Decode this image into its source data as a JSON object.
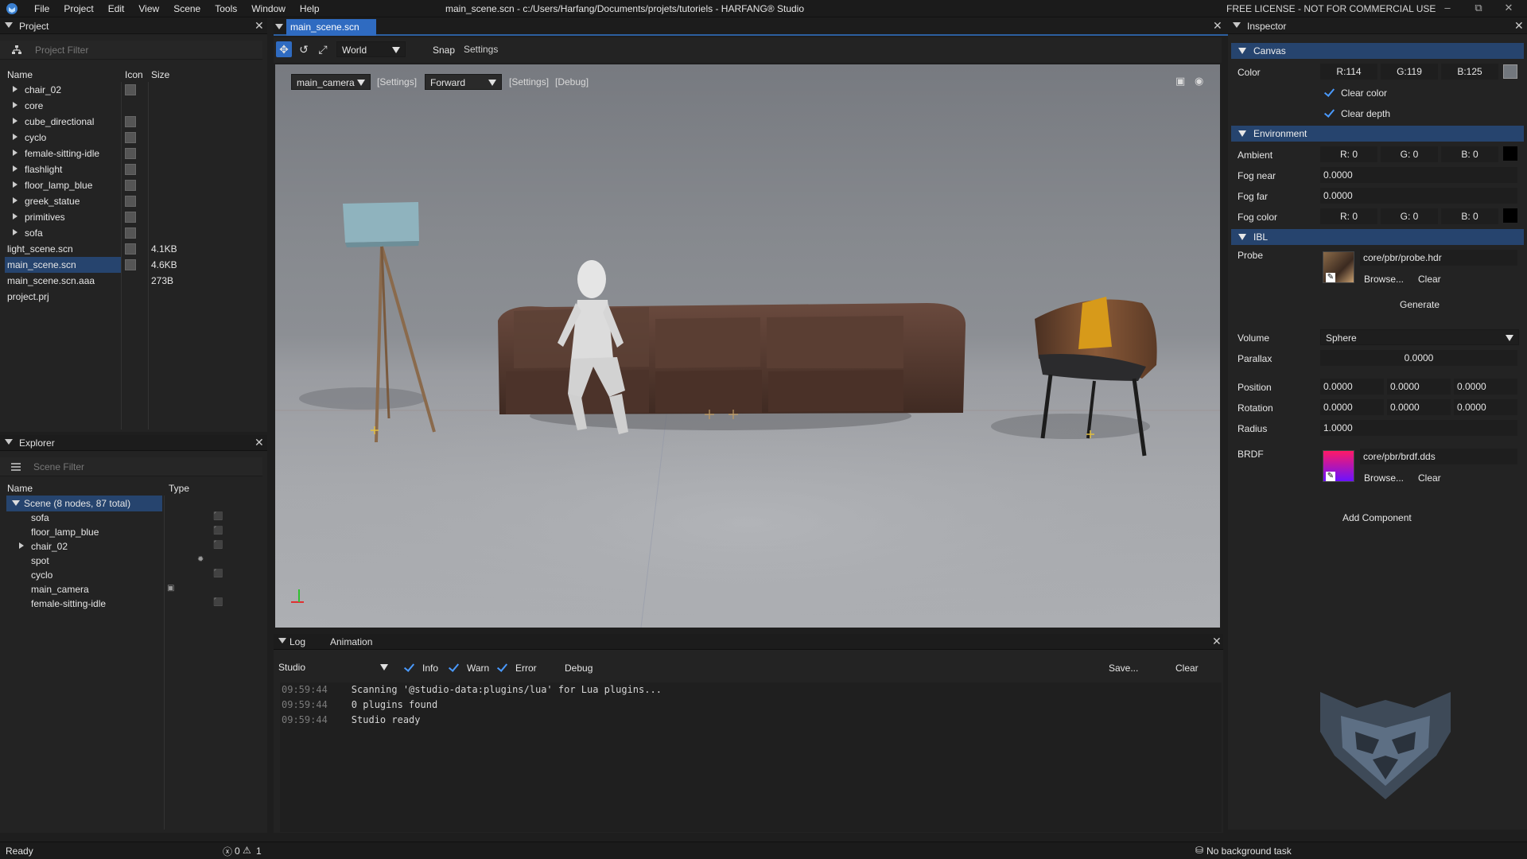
{
  "window": {
    "title": "main_scene.scn - c:/Users/Harfang/Documents/projets/tutoriels - HARFANG® Studio",
    "license": "FREE LICENSE - NOT FOR COMMERCIAL USE",
    "menu": [
      "File",
      "Project",
      "Edit",
      "View",
      "Scene",
      "Tools",
      "Window",
      "Help"
    ]
  },
  "project_panel": {
    "title": "Project",
    "filter_placeholder": "Project Filter",
    "columns": [
      "Name",
      "Icon",
      "Size"
    ],
    "items": [
      {
        "name": "chair_02",
        "folder": true,
        "size": ""
      },
      {
        "name": "core",
        "folder": true,
        "size": ""
      },
      {
        "name": "cube_directional",
        "folder": true,
        "size": ""
      },
      {
        "name": "cyclo",
        "folder": true,
        "size": ""
      },
      {
        "name": "female-sitting-idle",
        "folder": true,
        "size": ""
      },
      {
        "name": "flashlight",
        "folder": true,
        "size": ""
      },
      {
        "name": "floor_lamp_blue",
        "folder": true,
        "size": ""
      },
      {
        "name": "greek_statue",
        "folder": true,
        "size": ""
      },
      {
        "name": "primitives",
        "folder": true,
        "size": ""
      },
      {
        "name": "sofa",
        "folder": true,
        "size": ""
      },
      {
        "name": "light_scene.scn",
        "folder": false,
        "size": "4.1KB"
      },
      {
        "name": "main_scene.scn",
        "folder": false,
        "size": "4.6KB",
        "selected": true
      },
      {
        "name": "main_scene.scn.aaa",
        "folder": false,
        "size": "273B"
      },
      {
        "name": "project.prj",
        "folder": false,
        "size": ""
      }
    ]
  },
  "explorer_panel": {
    "title": "Explorer",
    "filter_placeholder": "Scene Filter",
    "columns": [
      "Name",
      "Type"
    ],
    "root": "Scene (8 nodes, 87 total)",
    "nodes": [
      {
        "name": "sofa",
        "type_icon": "object-icon"
      },
      {
        "name": "floor_lamp_blue",
        "type_icon": "object-icon"
      },
      {
        "name": "chair_02",
        "type_icon": "object-icon",
        "expandable": true
      },
      {
        "name": "spot",
        "type_icon": "light-icon"
      },
      {
        "name": "cyclo",
        "type_icon": "object-icon"
      },
      {
        "name": "main_camera",
        "type_icon": "camera-icon"
      },
      {
        "name": "female-sitting-idle",
        "type_icon": "object-icon"
      }
    ]
  },
  "viewport": {
    "tab": "main_scene.scn",
    "space": "World",
    "snap": "Snap",
    "settings": "Settings",
    "camera": "main_camera",
    "camera_settings": "[Settings]",
    "pipeline": "Forward",
    "pipeline_settings": "[Settings]",
    "debug": "[Debug]"
  },
  "log_panel": {
    "tabs": [
      "Log",
      "Animation"
    ],
    "source": "Studio",
    "filters": {
      "info": "Info",
      "warn": "Warn",
      "error": "Error",
      "debug": "Debug"
    },
    "save": "Save...",
    "clear": "Clear",
    "lines": [
      {
        "time": "09:59:44",
        "text": "Scanning '@studio-data:plugins/lua' for Lua plugins..."
      },
      {
        "time": "09:59:44",
        "text": "0 plugins found"
      },
      {
        "time": "09:59:44",
        "text": "Studio ready"
      }
    ]
  },
  "inspector": {
    "title": "Inspector",
    "canvas": {
      "title": "Canvas",
      "color_label": "Color",
      "r": "R:114",
      "g": "G:119",
      "b": "B:125",
      "swatch_color": "#72777d",
      "clear_color": "Clear color",
      "clear_depth": "Clear depth"
    },
    "environment": {
      "title": "Environment",
      "ambient_label": "Ambient",
      "ambient": {
        "r": "R:  0",
        "g": "G:  0",
        "b": "B:  0"
      },
      "fog_near_label": "Fog near",
      "fog_near": "0.0000",
      "fog_far_label": "Fog far",
      "fog_far": "0.0000",
      "fog_color_label": "Fog color",
      "fog_color": {
        "r": "R:  0",
        "g": "G:  0",
        "b": "B:  0"
      }
    },
    "ibl": {
      "title": "IBL",
      "probe_label": "Probe",
      "probe_path": "core/pbr/probe.hdr",
      "browse": "Browse...",
      "clear": "Clear",
      "generate": "Generate",
      "volume_label": "Volume",
      "volume": "Sphere",
      "parallax_label": "Parallax",
      "parallax": "0.0000",
      "position_label": "Position",
      "position": [
        "0.0000",
        "0.0000",
        "0.0000"
      ],
      "rotation_label": "Rotation",
      "rotation": [
        "0.0000",
        "0.0000",
        "0.0000"
      ],
      "radius_label": "Radius",
      "radius": "1.0000",
      "brdf_label": "BRDF",
      "brdf_path": "core/pbr/brdf.dds"
    },
    "add_component": "Add Component"
  },
  "statusbar": {
    "status": "Ready",
    "errors": "0",
    "warnings": "1",
    "task": "No background task"
  }
}
